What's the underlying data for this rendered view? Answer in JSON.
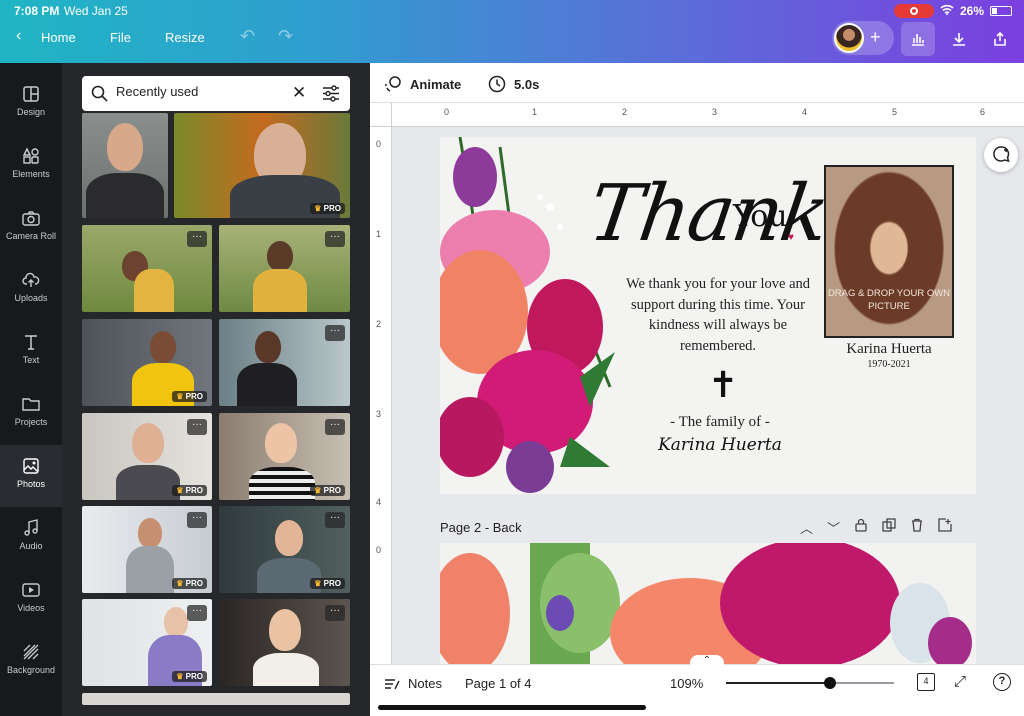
{
  "status_bar": {
    "time": "7:08 PM",
    "date": "Wed Jan 25",
    "battery": "26%"
  },
  "header": {
    "home_label": "Home",
    "file_label": "File",
    "resize_label": "Resize"
  },
  "rail": {
    "items": [
      {
        "label": "Design",
        "icon": "design-icon"
      },
      {
        "label": "Elements",
        "icon": "elements-icon"
      },
      {
        "label": "Camera Roll",
        "icon": "camera-icon"
      },
      {
        "label": "Uploads",
        "icon": "upload-icon"
      },
      {
        "label": "Text",
        "icon": "text-icon"
      },
      {
        "label": "Projects",
        "icon": "folder-icon"
      },
      {
        "label": "Photos",
        "icon": "photos-icon"
      },
      {
        "label": "Audio",
        "icon": "audio-icon"
      },
      {
        "label": "Videos",
        "icon": "video-icon"
      },
      {
        "label": "Background",
        "icon": "background-icon"
      }
    ],
    "active": "Photos"
  },
  "panel": {
    "search_value": "Recently used",
    "pro_label": "PRO",
    "more_label": "···"
  },
  "canvas_toolbar": {
    "animate_label": "Animate",
    "duration": "5.0s"
  },
  "ruler": {
    "top": [
      "0",
      "1",
      "2",
      "3",
      "4",
      "5",
      "6"
    ],
    "left": [
      "0",
      "1",
      "2",
      "3",
      "4",
      "0"
    ]
  },
  "card": {
    "title_thank": "Thank",
    "title_you": "You",
    "message": "We thank you for your love and support during this time. Your kindness will always be remembered.",
    "family_line": "- The family of -",
    "signature": "Karina Huerta",
    "portrait_placeholder": "DRAG & DROP YOUR OWN PICTURE",
    "name": "Karina Huerta",
    "years": "1970-2021"
  },
  "page2": {
    "label": "Page 2 - Back"
  },
  "bottom_bar": {
    "notes_label": "Notes",
    "page_indicator": "Page 1 of 4",
    "zoom": "109%",
    "page_count": "4",
    "zoom_fraction": 0.62
  },
  "colors": {
    "accent_gradient_start": "#1fb5c4",
    "accent_gradient_end": "#7b3fe0",
    "heart": "#c2185b"
  }
}
